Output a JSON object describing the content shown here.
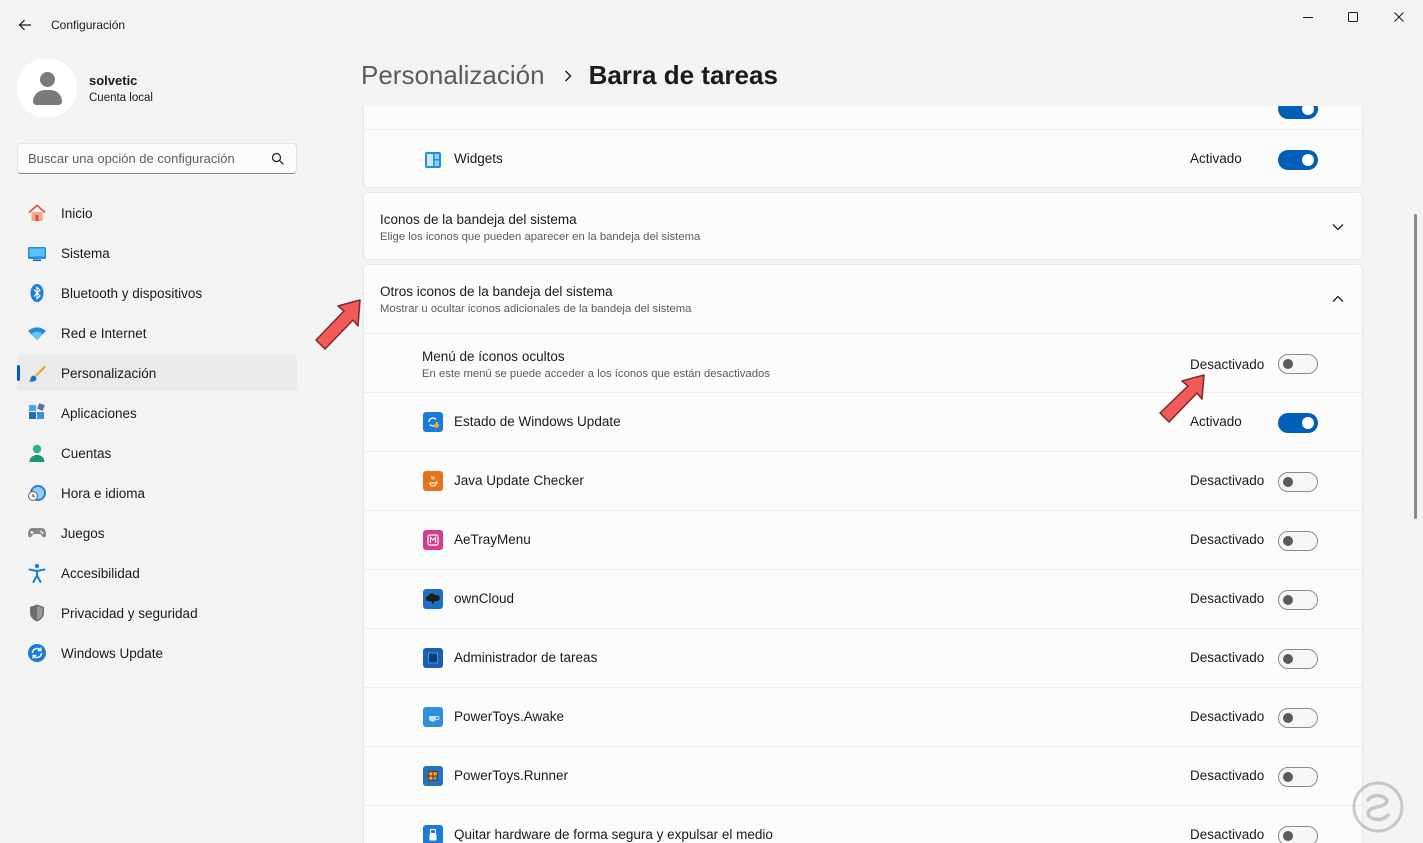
{
  "window": {
    "title": "Configuración",
    "back_icon": "back-arrow-icon",
    "controls": [
      "minimize-icon",
      "maximize-icon",
      "close-icon"
    ]
  },
  "profile": {
    "name": "solvetic",
    "account_type": "Cuenta local"
  },
  "search": {
    "placeholder": "Buscar una opción de configuración",
    "icon": "search-icon"
  },
  "nav": {
    "items": [
      {
        "label": "Inicio",
        "icon": "home-icon"
      },
      {
        "label": "Sistema",
        "icon": "monitor-icon"
      },
      {
        "label": "Bluetooth y dispositivos",
        "icon": "bluetooth-icon"
      },
      {
        "label": "Red e Internet",
        "icon": "wifi-icon"
      },
      {
        "label": "Personalización",
        "icon": "brush-icon",
        "active": true
      },
      {
        "label": "Aplicaciones",
        "icon": "apps-icon"
      },
      {
        "label": "Cuentas",
        "icon": "person-icon"
      },
      {
        "label": "Hora e idioma",
        "icon": "clock-globe-icon"
      },
      {
        "label": "Juegos",
        "icon": "gamepad-icon"
      },
      {
        "label": "Accesibilidad",
        "icon": "accessibility-icon"
      },
      {
        "label": "Privacidad y seguridad",
        "icon": "shield-icon"
      },
      {
        "label": "Windows Update",
        "icon": "update-icon"
      }
    ]
  },
  "header": {
    "parent": "Personalización",
    "current": "Barra de tareas"
  },
  "taskbar_items": {
    "widgets": {
      "label": "Widgets",
      "status": "Activado",
      "on": true
    }
  },
  "sections": {
    "tray_icons": {
      "title": "Iconos de la bandeja del sistema",
      "subtitle": "Elige los iconos que pueden aparecer en la bandeja del sistema",
      "expanded": false
    },
    "other_tray_icons": {
      "title": "Otros iconos de la bandeja del sistema",
      "subtitle": "Mostrar u ocultar iconos adicionales de la bandeja del sistema",
      "expanded": true,
      "hidden_menu": {
        "title": "Menú de íconos ocultos",
        "subtitle": "En este menú se puede acceder a los íconos que están desactivados",
        "status": "Desactivado",
        "on": false
      },
      "items": [
        {
          "label": "Estado de Windows Update",
          "status": "Activado",
          "on": true,
          "icon": "windows-update-status-icon",
          "color": "#1b7bd8"
        },
        {
          "label": "Java Update Checker",
          "status": "Desactivado",
          "on": false,
          "icon": "java-icon",
          "color": "#e7721c"
        },
        {
          "label": "AeTrayMenu",
          "status": "Desactivado",
          "on": false,
          "icon": "aetraymenu-icon",
          "color": "#d53b8c"
        },
        {
          "label": "ownCloud",
          "status": "Desactivado",
          "on": false,
          "icon": "owncloud-icon",
          "color": "#1f6fc0"
        },
        {
          "label": "Administrador de tareas",
          "status": "Desactivado",
          "on": false,
          "icon": "task-manager-icon",
          "color": "#1a5fb4"
        },
        {
          "label": "PowerToys.Awake",
          "status": "Desactivado",
          "on": false,
          "icon": "powertoys-awake-icon",
          "color": "#2f8fde"
        },
        {
          "label": "PowerToys.Runner",
          "status": "Desactivado",
          "on": false,
          "icon": "powertoys-runner-icon",
          "color": "#2471c8"
        },
        {
          "label": "Quitar hardware de forma segura y expulsar el medio",
          "status": "Desactivado",
          "on": false,
          "icon": "usb-eject-icon",
          "color": "#1b7bd8"
        }
      ]
    }
  },
  "colors": {
    "accent": "#005fb8",
    "annotation_arrow": "#f05252"
  }
}
